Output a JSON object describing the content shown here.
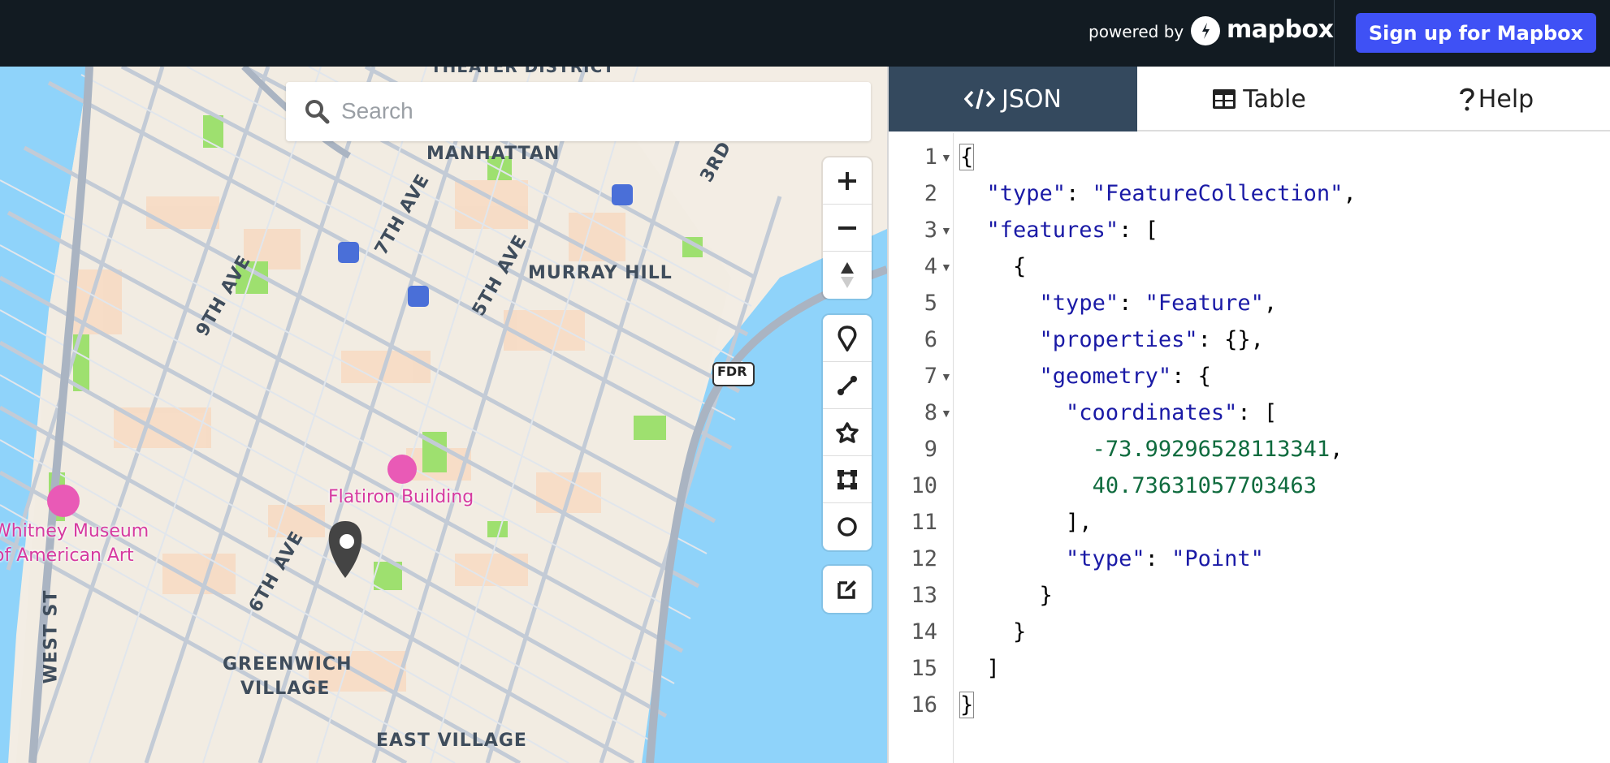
{
  "header": {
    "powered_by": "powered by",
    "brand": "mapbox",
    "signup_label": "Sign up for Mapbox"
  },
  "search": {
    "placeholder": "Search"
  },
  "map": {
    "labels": {
      "theater_district": "THEATER DISTRICT",
      "manhattan": "MANHATTAN",
      "murray_hill": "MURRAY HILL",
      "greenwich_village_1": "GREENWICH",
      "greenwich_village_2": "VILLAGE",
      "east_village": "EAST VILLAGE",
      "ave_7th": "7TH AVE",
      "ave_9th": "9TH AVE",
      "ave_5th": "5TH AVE",
      "ave_6th": "6TH AVE",
      "ave_3rd": "3RD",
      "west_st": "WEST ST",
      "fdr": "FDR"
    },
    "pois": {
      "flatiron": "Flatiron Building",
      "whitney_1": "Whitney Museum",
      "whitney_2": "of American Art"
    },
    "controls": [
      "zoom-in",
      "zoom-out",
      "compass",
      "draw-point",
      "draw-line",
      "draw-polygon",
      "draw-rectangle",
      "draw-circle",
      "edit"
    ],
    "colors": {
      "water": "#8fd3fa",
      "park": "#9ee06f",
      "street": "#c3cbd6",
      "marker": "#333333",
      "poi": "#d63aa0"
    }
  },
  "tabs": [
    {
      "label": "JSON",
      "icon": "code-icon",
      "active": true
    },
    {
      "label": "Table",
      "icon": "table-icon",
      "active": false
    },
    {
      "label": "Help",
      "icon": "question-icon",
      "active": false
    }
  ],
  "editor": {
    "line_numbers": [
      "1",
      "2",
      "3",
      "4",
      "5",
      "6",
      "7",
      "8",
      "9",
      "10",
      "11",
      "12",
      "13",
      "14",
      "15",
      "16"
    ],
    "lines": [
      "{",
      "  \"type\": \"FeatureCollection\",",
      "  \"features\": [",
      "    {",
      "      \"type\": \"Feature\",",
      "      \"properties\": {},",
      "      \"geometry\": {",
      "        \"coordinates\": [",
      "          -73.99296528113341,",
      "          40.73631057703463",
      "        ],",
      "        \"type\": \"Point\"",
      "      }",
      "    }",
      "  ]",
      "}"
    ],
    "values": {
      "type_key": "\"type\"",
      "fc": "\"FeatureCollection\"",
      "features_key": "\"features\"",
      "feature": "\"Feature\"",
      "properties_key": "\"properties\"",
      "geometry_key": "\"geometry\"",
      "coordinates_key": "\"coordinates\"",
      "lon": "-73.99296528113341",
      "lat": "40.73631057703463",
      "point": "\"Point\""
    }
  }
}
